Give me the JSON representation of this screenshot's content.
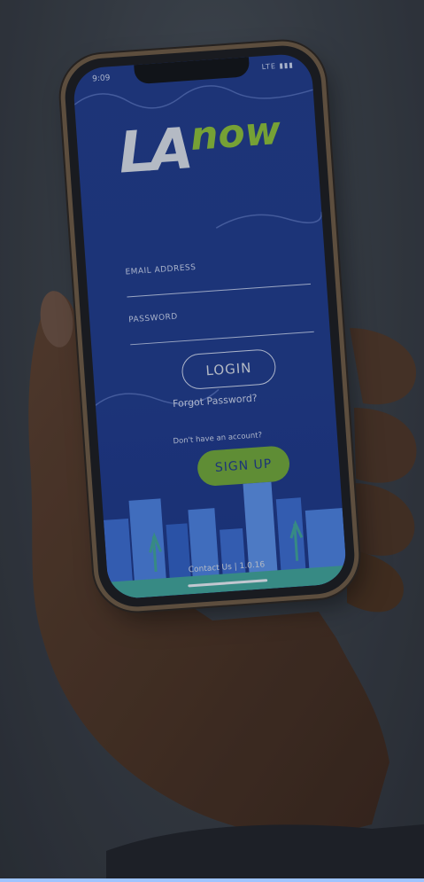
{
  "status_bar": {
    "time": "9:09",
    "indicators": "LTE ▮▮▮"
  },
  "app": {
    "logo": {
      "la": "LA",
      "now": "now"
    },
    "email_label": "EMAIL ADDRESS",
    "password_label": "PASSWORD",
    "login_label": "LOGIN",
    "forgot_password": "Forgot Password?",
    "no_account": "Don't have an account?",
    "signup_label": "SIGN UP",
    "footer": "Contact Us | 1.0.16"
  },
  "colors": {
    "screen_blue": "#1e3a8c",
    "logo_green": "#8bbf3a",
    "signup_green": "#6fa63a",
    "logo_light": "#d7dde8"
  }
}
